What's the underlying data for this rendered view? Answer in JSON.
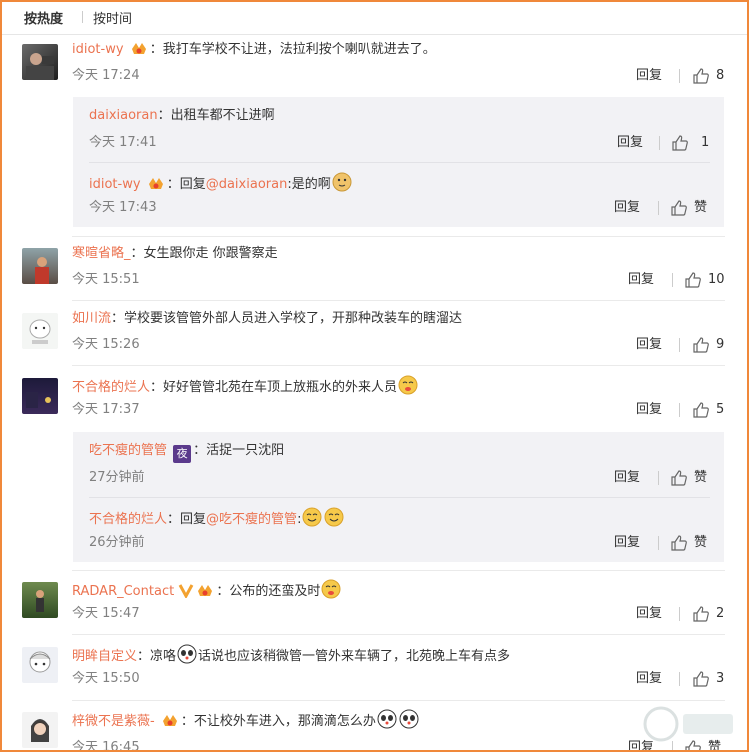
{
  "tabs": {
    "hot": "按热度",
    "time": "按时间"
  },
  "actions": {
    "reply": "回复",
    "like": "赞"
  },
  "colors": {
    "username": "#eb7350",
    "frame": "#f0883a",
    "subbox": "#f2f2f5"
  },
  "comments": [
    {
      "user": "idiot-wy",
      "sep": "：",
      "text": "我打车学校不让进，法拉利按个喇叭就进去了。",
      "time": "今天 17:24",
      "likes": "8",
      "replies": [
        {
          "user": "daixiaoran",
          "sep": "：",
          "text": "出租车都不让进啊",
          "time": "今天 17:41",
          "likes": "1"
        },
        {
          "user": "idiot-wy",
          "sep": "：",
          "prefix": "回复",
          "mention": "@daixiaoran",
          "text": ":是的啊",
          "time": "今天 17:43"
        }
      ]
    },
    {
      "user": "寒暄省略_",
      "sep": "：",
      "text": "女生跟你走 你跟警察走",
      "time": "今天 15:51",
      "likes": "10"
    },
    {
      "user": "如川流",
      "sep": "：",
      "text": "学校要该管管外部人员进入学校了，开那种改装车的瞎溜达",
      "time": "今天 15:26",
      "likes": "9"
    },
    {
      "user": "不合格的烂人",
      "sep": "：",
      "text": "好好管管北苑在车顶上放瓶水的外来人员",
      "time": "今天 17:37",
      "likes": "5",
      "replies": [
        {
          "user": "吃不瘦的管管",
          "sep": "：",
          "text": "活捉一只沈阳",
          "time": "27分钟前"
        },
        {
          "user": "不合格的烂人",
          "sep": "：",
          "prefix": "回复",
          "mention": "@吃不瘦的管管",
          "text": ":",
          "time": "26分钟前"
        }
      ]
    },
    {
      "user": "RADAR_Contact",
      "sep": "：",
      "text": "公布的还蛮及时",
      "time": "今天 15:47",
      "likes": "2"
    },
    {
      "user": "明眸自定义",
      "sep": "：",
      "text": "凉咯",
      "text2": "话说也应该稍微管一管外来车辆了，北苑晚上车有点多",
      "time": "今天 15:50",
      "likes": "3"
    },
    {
      "user": "梓微不是紫薇-",
      "sep": "：",
      "text": "不让校外车进入，那滴滴怎么办",
      "time": "今天 16:45"
    }
  ]
}
